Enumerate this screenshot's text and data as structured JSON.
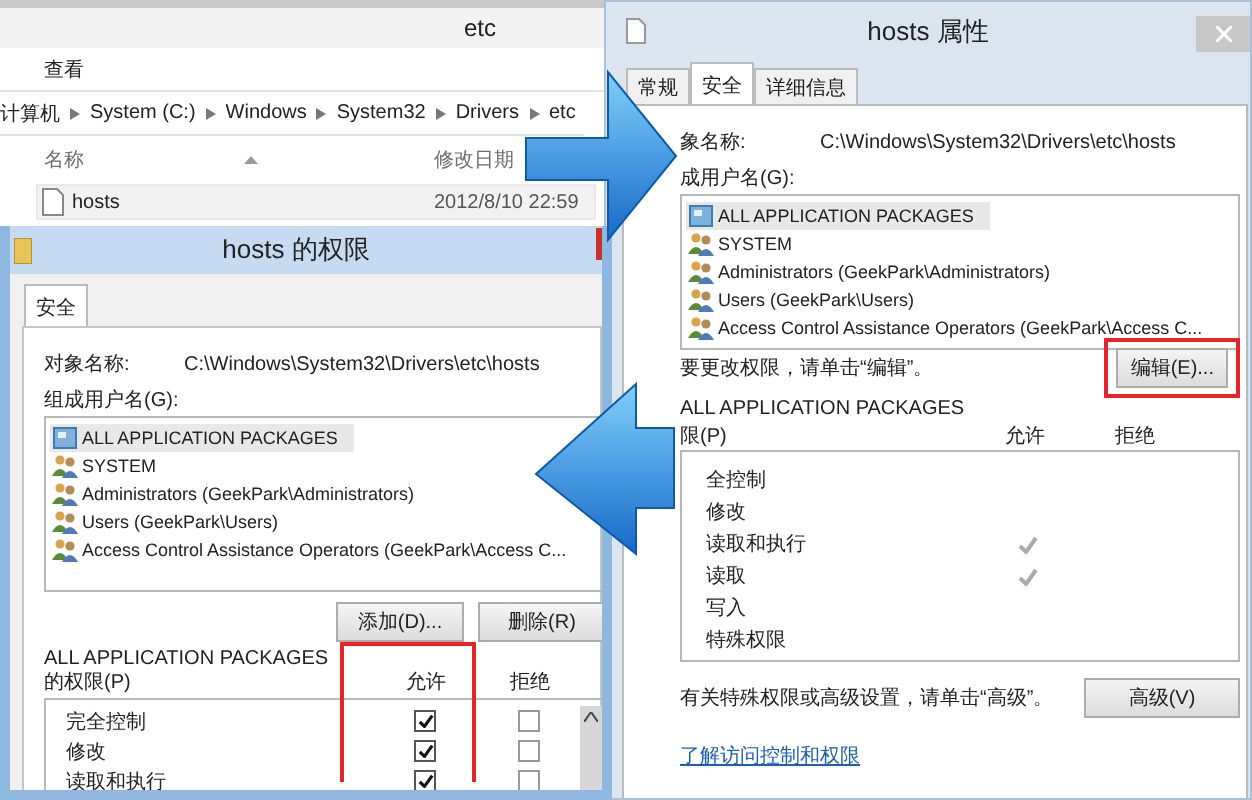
{
  "explorer": {
    "title": "etc",
    "ribbon_tab": "查看",
    "breadcrumb": [
      "计算机",
      "System (C:)",
      "Windows",
      "System32",
      "Drivers",
      "etc"
    ],
    "columns": [
      "名称",
      "修改日期"
    ],
    "files": [
      {
        "name": "hosts",
        "modified": "2012/8/10 22:59"
      }
    ]
  },
  "properties_window": {
    "title": "hosts 属性",
    "tabs": [
      {
        "label": "常规",
        "selected": false
      },
      {
        "label": "安全",
        "selected": true
      },
      {
        "label": "详细信息",
        "selected": false
      }
    ],
    "object_label": "象名称:",
    "object_path": "C:\\Windows\\System32\\Drivers\\etc\\hosts",
    "group_label": "成用户名(G):",
    "users": [
      {
        "kind": "package",
        "name": "ALL APPLICATION PACKAGES",
        "selected": true
      },
      {
        "kind": "group",
        "name": "SYSTEM",
        "selected": false
      },
      {
        "kind": "group",
        "name": "Administrators (GeekPark\\Administrators)",
        "selected": false
      },
      {
        "kind": "group",
        "name": "Users (GeekPark\\Users)",
        "selected": false
      },
      {
        "kind": "group",
        "name": "Access Control Assistance Operators (GeekPark\\Access C...",
        "selected": false
      }
    ],
    "edit_hint": "要更改权限，请单击“编辑”。",
    "edit_button": "编辑(E)...",
    "permissions_for": "ALL APPLICATION PACKAGES",
    "permissions_label": "限(P)",
    "allow_header": "允许",
    "deny_header": "拒绝",
    "permissions": [
      {
        "name": "全控制",
        "allowed": false
      },
      {
        "name": "修改",
        "allowed": false
      },
      {
        "name": "读取和执行",
        "allowed": true
      },
      {
        "name": "读取",
        "allowed": true
      },
      {
        "name": "写入",
        "allowed": false
      },
      {
        "name": "特殊权限",
        "allowed": false
      }
    ],
    "advanced_hint": "有关特殊权限或高级设置，请单击“高级”。",
    "advanced_button": "高级(V)",
    "learn_link": "了解访问控制和权限"
  },
  "permissions_window": {
    "title": "hosts 的权限",
    "tabs": [
      {
        "label": "安全",
        "selected": true
      }
    ],
    "object_label": "对象名称:",
    "object_path": "C:\\Windows\\System32\\Drivers\\etc\\hosts",
    "group_label": "组成用户名(G):",
    "users": [
      {
        "kind": "package",
        "name": "ALL APPLICATION PACKAGES",
        "selected": true
      },
      {
        "kind": "group",
        "name": "SYSTEM",
        "selected": false
      },
      {
        "kind": "group",
        "name": "Administrators (GeekPark\\Administrators)",
        "selected": false
      },
      {
        "kind": "group",
        "name": "Users (GeekPark\\Users)",
        "selected": false
      },
      {
        "kind": "group",
        "name": "Access Control Assistance Operators (GeekPark\\Access C...",
        "selected": false
      }
    ],
    "buttons": [
      "添加(D)...",
      "删除(R)"
    ],
    "permissions_for": "ALL APPLICATION PACKAGES",
    "permissions_label": "的权限(P)",
    "allow_header": "允许",
    "deny_header": "拒绝",
    "permissions": [
      {
        "name": "完全控制",
        "allow": true,
        "deny": false
      },
      {
        "name": "修改",
        "allow": true,
        "deny": false
      },
      {
        "name": "读取和执行",
        "allow": true,
        "deny": false
      }
    ]
  }
}
